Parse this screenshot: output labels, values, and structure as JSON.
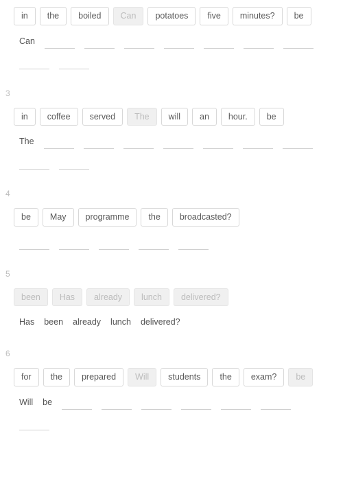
{
  "questions": [
    {
      "number": "",
      "words": [
        {
          "text": "in",
          "used": false
        },
        {
          "text": "the",
          "used": false
        },
        {
          "text": "boiled",
          "used": false
        },
        {
          "text": "Can",
          "used": true
        },
        {
          "text": "potatoes",
          "used": false
        },
        {
          "text": "five",
          "used": false
        },
        {
          "text": "minutes?",
          "used": false
        },
        {
          "text": "be",
          "used": false
        }
      ],
      "placed": [
        "Can"
      ],
      "blank_slots": 9
    },
    {
      "number": "3",
      "words": [
        {
          "text": "in",
          "used": false
        },
        {
          "text": "coffee",
          "used": false
        },
        {
          "text": "served",
          "used": false
        },
        {
          "text": "The",
          "used": true
        },
        {
          "text": "will",
          "used": false
        },
        {
          "text": "an",
          "used": false
        },
        {
          "text": "hour.",
          "used": false
        },
        {
          "text": "be",
          "used": false
        }
      ],
      "placed": [
        "The"
      ],
      "blank_slots": 9
    },
    {
      "number": "4",
      "words": [
        {
          "text": "be",
          "used": false
        },
        {
          "text": "May",
          "used": false
        },
        {
          "text": "programme",
          "used": false
        },
        {
          "text": "the",
          "used": false
        },
        {
          "text": "broadcasted?",
          "used": false
        }
      ],
      "placed": [],
      "blank_slots": 5
    },
    {
      "number": "5",
      "words": [
        {
          "text": "been",
          "used": true
        },
        {
          "text": "Has",
          "used": true
        },
        {
          "text": "already",
          "used": true
        },
        {
          "text": "lunch",
          "used": true
        },
        {
          "text": "delivered?",
          "used": true
        }
      ],
      "placed": [
        "Has",
        "been",
        "already",
        "lunch",
        "delivered?"
      ],
      "blank_slots": 0
    },
    {
      "number": "6",
      "words": [
        {
          "text": "for",
          "used": false
        },
        {
          "text": "the",
          "used": false
        },
        {
          "text": "prepared",
          "used": false
        },
        {
          "text": "Will",
          "used": true
        },
        {
          "text": "students",
          "used": false
        },
        {
          "text": "the",
          "used": false
        },
        {
          "text": "exam?",
          "used": false
        },
        {
          "text": "be",
          "used": true
        }
      ],
      "placed": [
        "Will",
        "be"
      ],
      "blank_slots": 7
    }
  ]
}
